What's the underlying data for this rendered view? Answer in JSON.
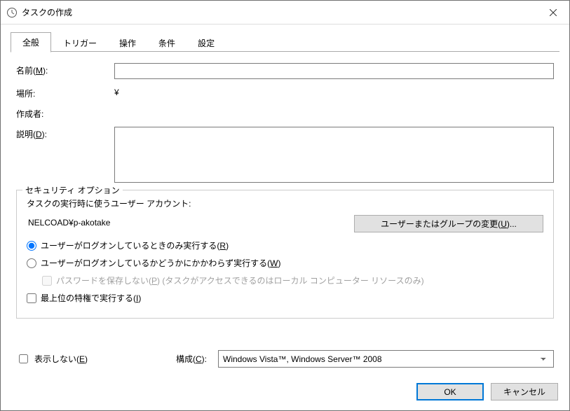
{
  "window": {
    "title": "タスクの作成"
  },
  "tabs": [
    "全般",
    "トリガー",
    "操作",
    "条件",
    "設定"
  ],
  "form": {
    "name_label_prefix": "名前(",
    "name_label_key": "M",
    "name_label_suffix": "):",
    "name_value": "",
    "location_label": "場所:",
    "location_value": "¥",
    "author_label": "作成者:",
    "author_value": "",
    "desc_label_prefix": "説明(",
    "desc_label_key": "D",
    "desc_label_suffix": "):",
    "desc_value": ""
  },
  "security": {
    "legend": "セキュリティ オプション",
    "account_label": "タスクの実行時に使うユーザー アカウント:",
    "account_value": "NELCOAD¥p-akotake",
    "change_btn_prefix": "ユーザーまたはグループの変更(",
    "change_btn_key": "U",
    "change_btn_suffix": ")...",
    "radio_loggedon_prefix": "ユーザーがログオンしているときのみ実行する(",
    "radio_loggedon_key": "R",
    "radio_loggedon_suffix": ")",
    "radio_always_prefix": "ユーザーがログオンしているかどうかにかかわらず実行する(",
    "radio_always_key": "W",
    "radio_always_suffix": ")",
    "chk_nopw_prefix": "パスワードを保存しない(",
    "chk_nopw_key": "P",
    "chk_nopw_suffix": ") (タスクがアクセスできるのはローカル コンピューター リソースのみ)",
    "chk_highest_prefix": "最上位の特権で実行する(",
    "chk_highest_key": "I",
    "chk_highest_suffix": ")"
  },
  "bottom": {
    "chk_hide_prefix": "表示しない(",
    "chk_hide_key": "E",
    "chk_hide_suffix": ")",
    "config_label_prefix": "構成(",
    "config_label_key": "C",
    "config_label_suffix": "):",
    "config_value": "Windows Vista™, Windows Server™ 2008"
  },
  "footer": {
    "ok": "OK",
    "cancel": "キャンセル"
  }
}
